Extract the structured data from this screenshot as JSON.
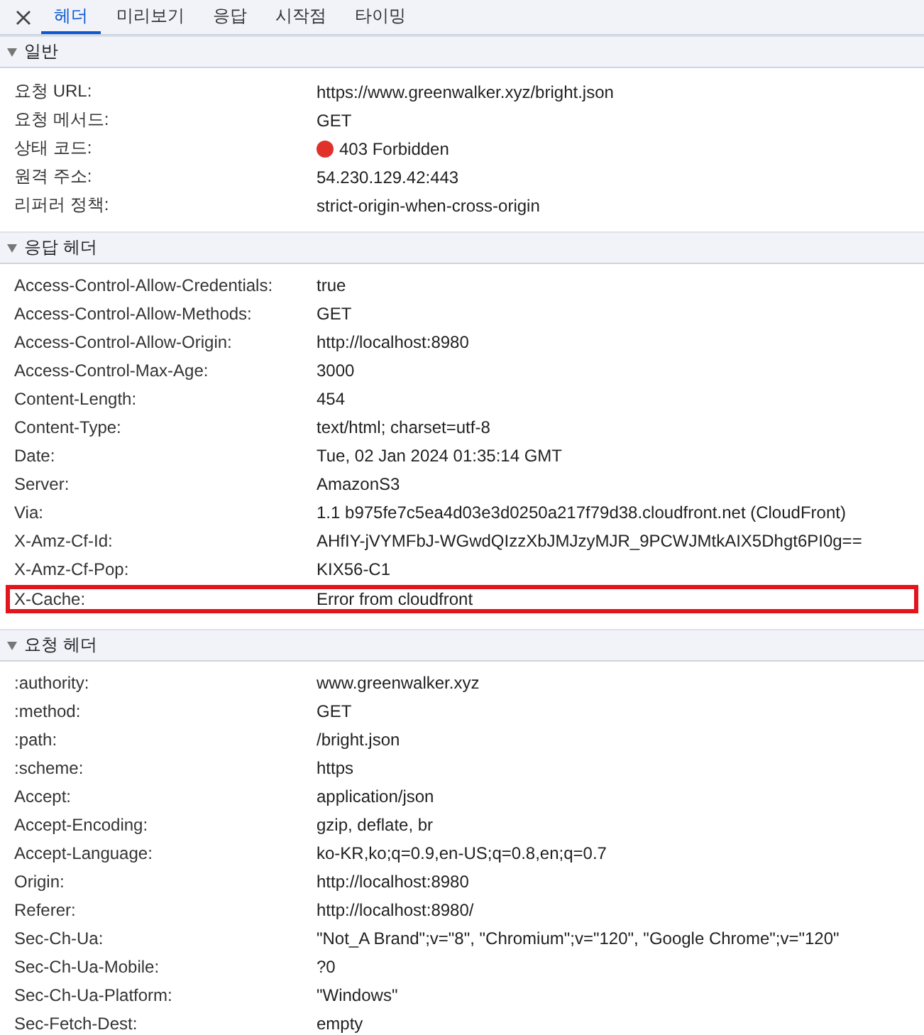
{
  "tabs": [
    {
      "label": "헤더",
      "selected": true
    },
    {
      "label": "미리보기",
      "selected": false
    },
    {
      "label": "응답",
      "selected": false
    },
    {
      "label": "시작점",
      "selected": false
    },
    {
      "label": "타이밍",
      "selected": false
    }
  ],
  "sections": [
    {
      "title": "일반",
      "expanded": true,
      "rows": [
        {
          "name": "요청 URL:",
          "value": "https://www.greenwalker.xyz/bright.json",
          "kind": "text",
          "highlighted": false
        },
        {
          "name": "요청 메서드:",
          "value": "GET",
          "kind": "text",
          "highlighted": false
        },
        {
          "name": "상태 코드:",
          "value": "403 Forbidden",
          "kind": "status",
          "color": "#e0312b",
          "highlighted": false
        },
        {
          "name": "원격 주소:",
          "value": "54.230.129.42:443",
          "kind": "text",
          "highlighted": false
        },
        {
          "name": "리퍼러 정책:",
          "value": "strict-origin-when-cross-origin",
          "kind": "text",
          "highlighted": false
        }
      ]
    },
    {
      "title": "응답 헤더",
      "expanded": true,
      "rows": [
        {
          "name": "Access-Control-Allow-Credentials:",
          "value": "true",
          "kind": "text",
          "highlighted": false
        },
        {
          "name": "Access-Control-Allow-Methods:",
          "value": "GET",
          "kind": "text",
          "highlighted": false
        },
        {
          "name": "Access-Control-Allow-Origin:",
          "value": "http://localhost:8980",
          "kind": "text",
          "highlighted": false
        },
        {
          "name": "Access-Control-Max-Age:",
          "value": "3000",
          "kind": "text",
          "highlighted": false
        },
        {
          "name": "Content-Length:",
          "value": "454",
          "kind": "text",
          "highlighted": false
        },
        {
          "name": "Content-Type:",
          "value": "text/html; charset=utf-8",
          "kind": "text",
          "highlighted": false
        },
        {
          "name": "Date:",
          "value": "Tue, 02 Jan 2024 01:35:14 GMT",
          "kind": "text",
          "highlighted": false
        },
        {
          "name": "Server:",
          "value": "AmazonS3",
          "kind": "text",
          "highlighted": false
        },
        {
          "name": "Via:",
          "value": "1.1 b975fe7c5ea4d03e3d0250a217f79d38.cloudfront.net (CloudFront)",
          "kind": "text",
          "highlighted": false
        },
        {
          "name": "X-Amz-Cf-Id:",
          "value": "AHfIY-jVYMFbJ-WGwdQIzzXbJMJzyMJR_9PCWJMtkAIX5Dhgt6PI0g==",
          "kind": "text",
          "highlighted": false
        },
        {
          "name": "X-Amz-Cf-Pop:",
          "value": "KIX56-C1",
          "kind": "text",
          "highlighted": false
        },
        {
          "name": "X-Cache:",
          "value": "Error from cloudfront",
          "kind": "text",
          "highlighted": true
        }
      ]
    },
    {
      "title": "요청 헤더",
      "expanded": true,
      "rows": [
        {
          "name": ":authority:",
          "value": "www.greenwalker.xyz",
          "kind": "text",
          "highlighted": false
        },
        {
          "name": ":method:",
          "value": "GET",
          "kind": "text",
          "highlighted": false
        },
        {
          "name": ":path:",
          "value": "/bright.json",
          "kind": "text",
          "highlighted": false
        },
        {
          "name": ":scheme:",
          "value": "https",
          "kind": "text",
          "highlighted": false
        },
        {
          "name": "Accept:",
          "value": "application/json",
          "kind": "text",
          "highlighted": false
        },
        {
          "name": "Accept-Encoding:",
          "value": "gzip, deflate, br",
          "kind": "text",
          "highlighted": false
        },
        {
          "name": "Accept-Language:",
          "value": "ko-KR,ko;q=0.9,en-US;q=0.8,en;q=0.7",
          "kind": "text",
          "highlighted": false
        },
        {
          "name": "Origin:",
          "value": "http://localhost:8980",
          "kind": "text",
          "highlighted": false
        },
        {
          "name": "Referer:",
          "value": "http://localhost:8980/",
          "kind": "text",
          "highlighted": false
        },
        {
          "name": "Sec-Ch-Ua:",
          "value": "\"Not_A Brand\";v=\"8\", \"Chromium\";v=\"120\", \"Google Chrome\";v=\"120\"",
          "kind": "text",
          "highlighted": false
        },
        {
          "name": "Sec-Ch-Ua-Mobile:",
          "value": "?0",
          "kind": "text",
          "highlighted": false
        },
        {
          "name": "Sec-Ch-Ua-Platform:",
          "value": "\"Windows\"",
          "kind": "text",
          "highlighted": false
        },
        {
          "name": "Sec-Fetch-Dest:",
          "value": "empty",
          "kind": "text",
          "highlighted": false
        }
      ]
    }
  ]
}
